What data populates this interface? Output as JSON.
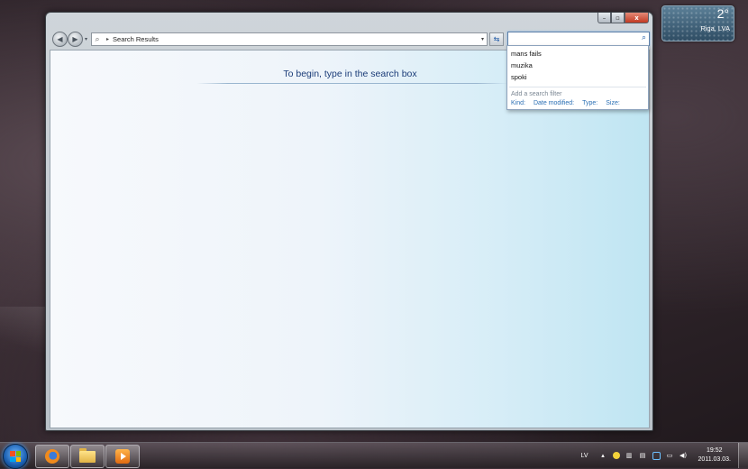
{
  "gadget": {
    "temperature": "2°",
    "city": "Riga, LVA"
  },
  "window": {
    "controls": {
      "minimize": "–",
      "maximize": "▫",
      "close": "x"
    },
    "nav": {
      "back": "◀",
      "forward": "▶",
      "dropdown": "▾"
    },
    "address": {
      "breadcrumb": "Search Results",
      "separator": "▸",
      "dropdown": "▾"
    },
    "search": {
      "value": "",
      "icon": "search-icon"
    },
    "content": {
      "hint": "To begin, type in the search box"
    }
  },
  "dropdown": {
    "suggestions": [
      "mans fails",
      "muzika",
      "spoki"
    ],
    "filter_title": "Add a search filter",
    "filters": [
      "Kind:",
      "Date modified:",
      "Type:",
      "Size:"
    ]
  },
  "taskbar": {
    "pinned": [
      "firefox-icon",
      "windows-explorer-icon",
      "media-player-icon"
    ],
    "language": "LV",
    "clock": {
      "time": "19:52",
      "date": "2011.03.03."
    }
  }
}
